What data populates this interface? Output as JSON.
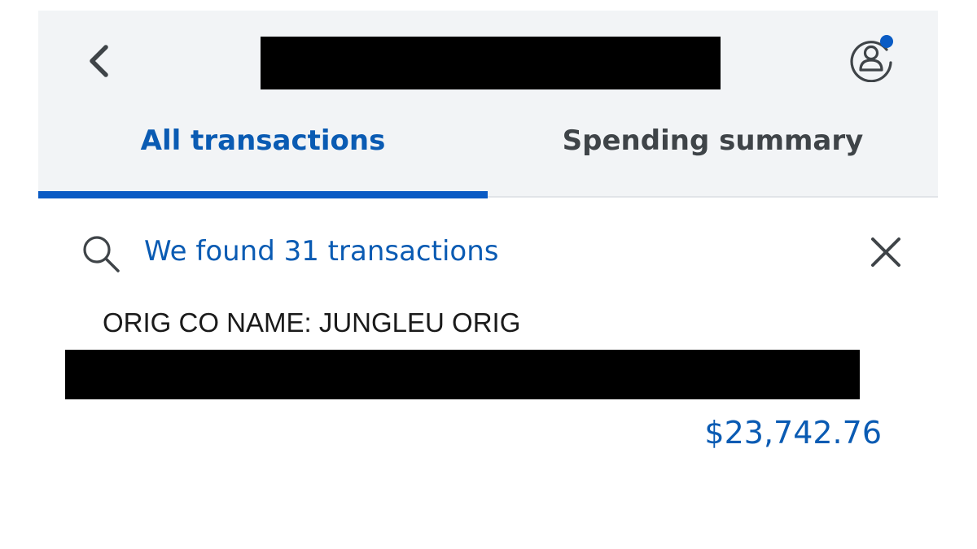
{
  "header": {
    "back_icon": "chevron-left-icon",
    "title_redacted": true,
    "profile_icon": "profile-icon",
    "has_notification": true
  },
  "tabs": [
    {
      "label": "All transactions",
      "active": true
    },
    {
      "label": "Spending summary",
      "active": false
    }
  ],
  "search": {
    "icon": "search-icon",
    "result_text": "We found 31 transactions",
    "close_icon": "close-icon"
  },
  "transaction": {
    "name": "ORIG CO NAME: JUNGLEU ORIG",
    "detail_redacted": true,
    "amount": "$23,742.76"
  },
  "colors": {
    "accent": "#0a5bc4",
    "header_bg": "#f2f4f6",
    "redaction": "#000000"
  }
}
